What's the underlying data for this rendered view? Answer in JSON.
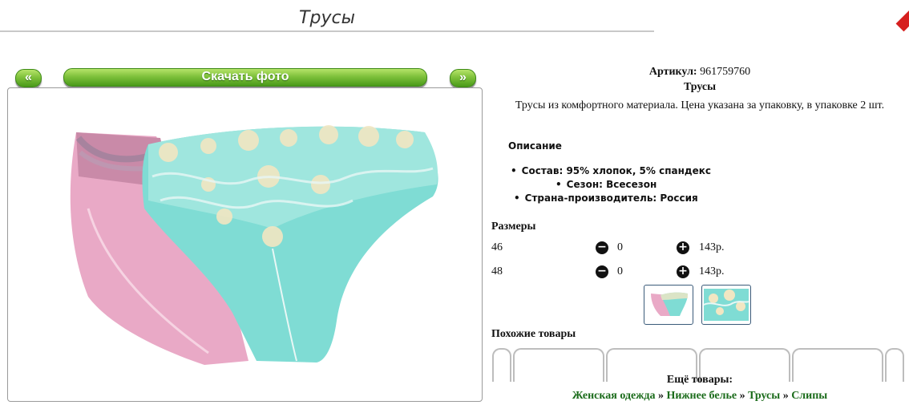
{
  "page": {
    "title": "Трусы"
  },
  "gallery": {
    "prev_label": "«",
    "download_label": "Скачать фото",
    "next_label": "»"
  },
  "product": {
    "sku_label": "Артикул:",
    "sku_value": "961759760",
    "name": "Трусы",
    "description": "Трусы из комфортного материала. Цена указана за упаковку, в упаковке 2 шт."
  },
  "details": {
    "heading": "Описание",
    "attributes": [
      "Состав: 95% хлопок, 5% спандекс",
      "Сезон: Всесезон",
      "Страна-производитель: Россия"
    ]
  },
  "sizes": {
    "heading": "Размеры",
    "rows": [
      {
        "size": "46",
        "qty": "0",
        "price": "143р."
      },
      {
        "size": "48",
        "qty": "0",
        "price": "143р."
      }
    ]
  },
  "similar": {
    "heading": "Похожие товары"
  },
  "more": {
    "heading": "Ещё товары:",
    "breadcrumb": [
      "Женская одежда",
      "Нижнее белье",
      "Трусы",
      "Слипы"
    ],
    "separator": "»"
  },
  "colors": {
    "accent_green": "#7fc13b",
    "link_green": "#1a6b1a",
    "pink_item": "#e9a9c6",
    "turquoise_item": "#7fdcd4"
  }
}
